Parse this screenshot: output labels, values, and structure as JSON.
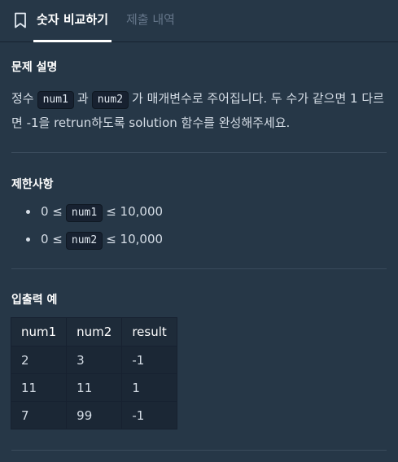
{
  "tabs": [
    {
      "label": "숫자 비교하기",
      "active": true
    },
    {
      "label": "제출 내역",
      "active": false
    }
  ],
  "problem": {
    "title": "문제 설명",
    "desc_parts": [
      "정수",
      "num1",
      "과",
      "num2",
      "가 매개변수로 주어집니다. 두 수가 같으면 1 다르면 -1을 retrun하도록 solution 함수를 완성해주세요."
    ]
  },
  "constraints": {
    "title": "제한사항",
    "items": [
      {
        "prefix": "0 ≤",
        "code": "num1",
        "suffix": "≤ 10,000"
      },
      {
        "prefix": "0 ≤",
        "code": "num2",
        "suffix": "≤ 10,000"
      }
    ]
  },
  "examples": {
    "title": "입출력 예",
    "headers": [
      "num1",
      "num2",
      "result"
    ],
    "rows": [
      [
        "2",
        "3",
        "-1"
      ],
      [
        "11",
        "11",
        "1"
      ],
      [
        "7",
        "99",
        "-1"
      ]
    ]
  },
  "colors": {
    "background": "#263747",
    "code_bg": "#172130",
    "active_tab": "#ffffff",
    "inactive_tab": "#65768a"
  }
}
